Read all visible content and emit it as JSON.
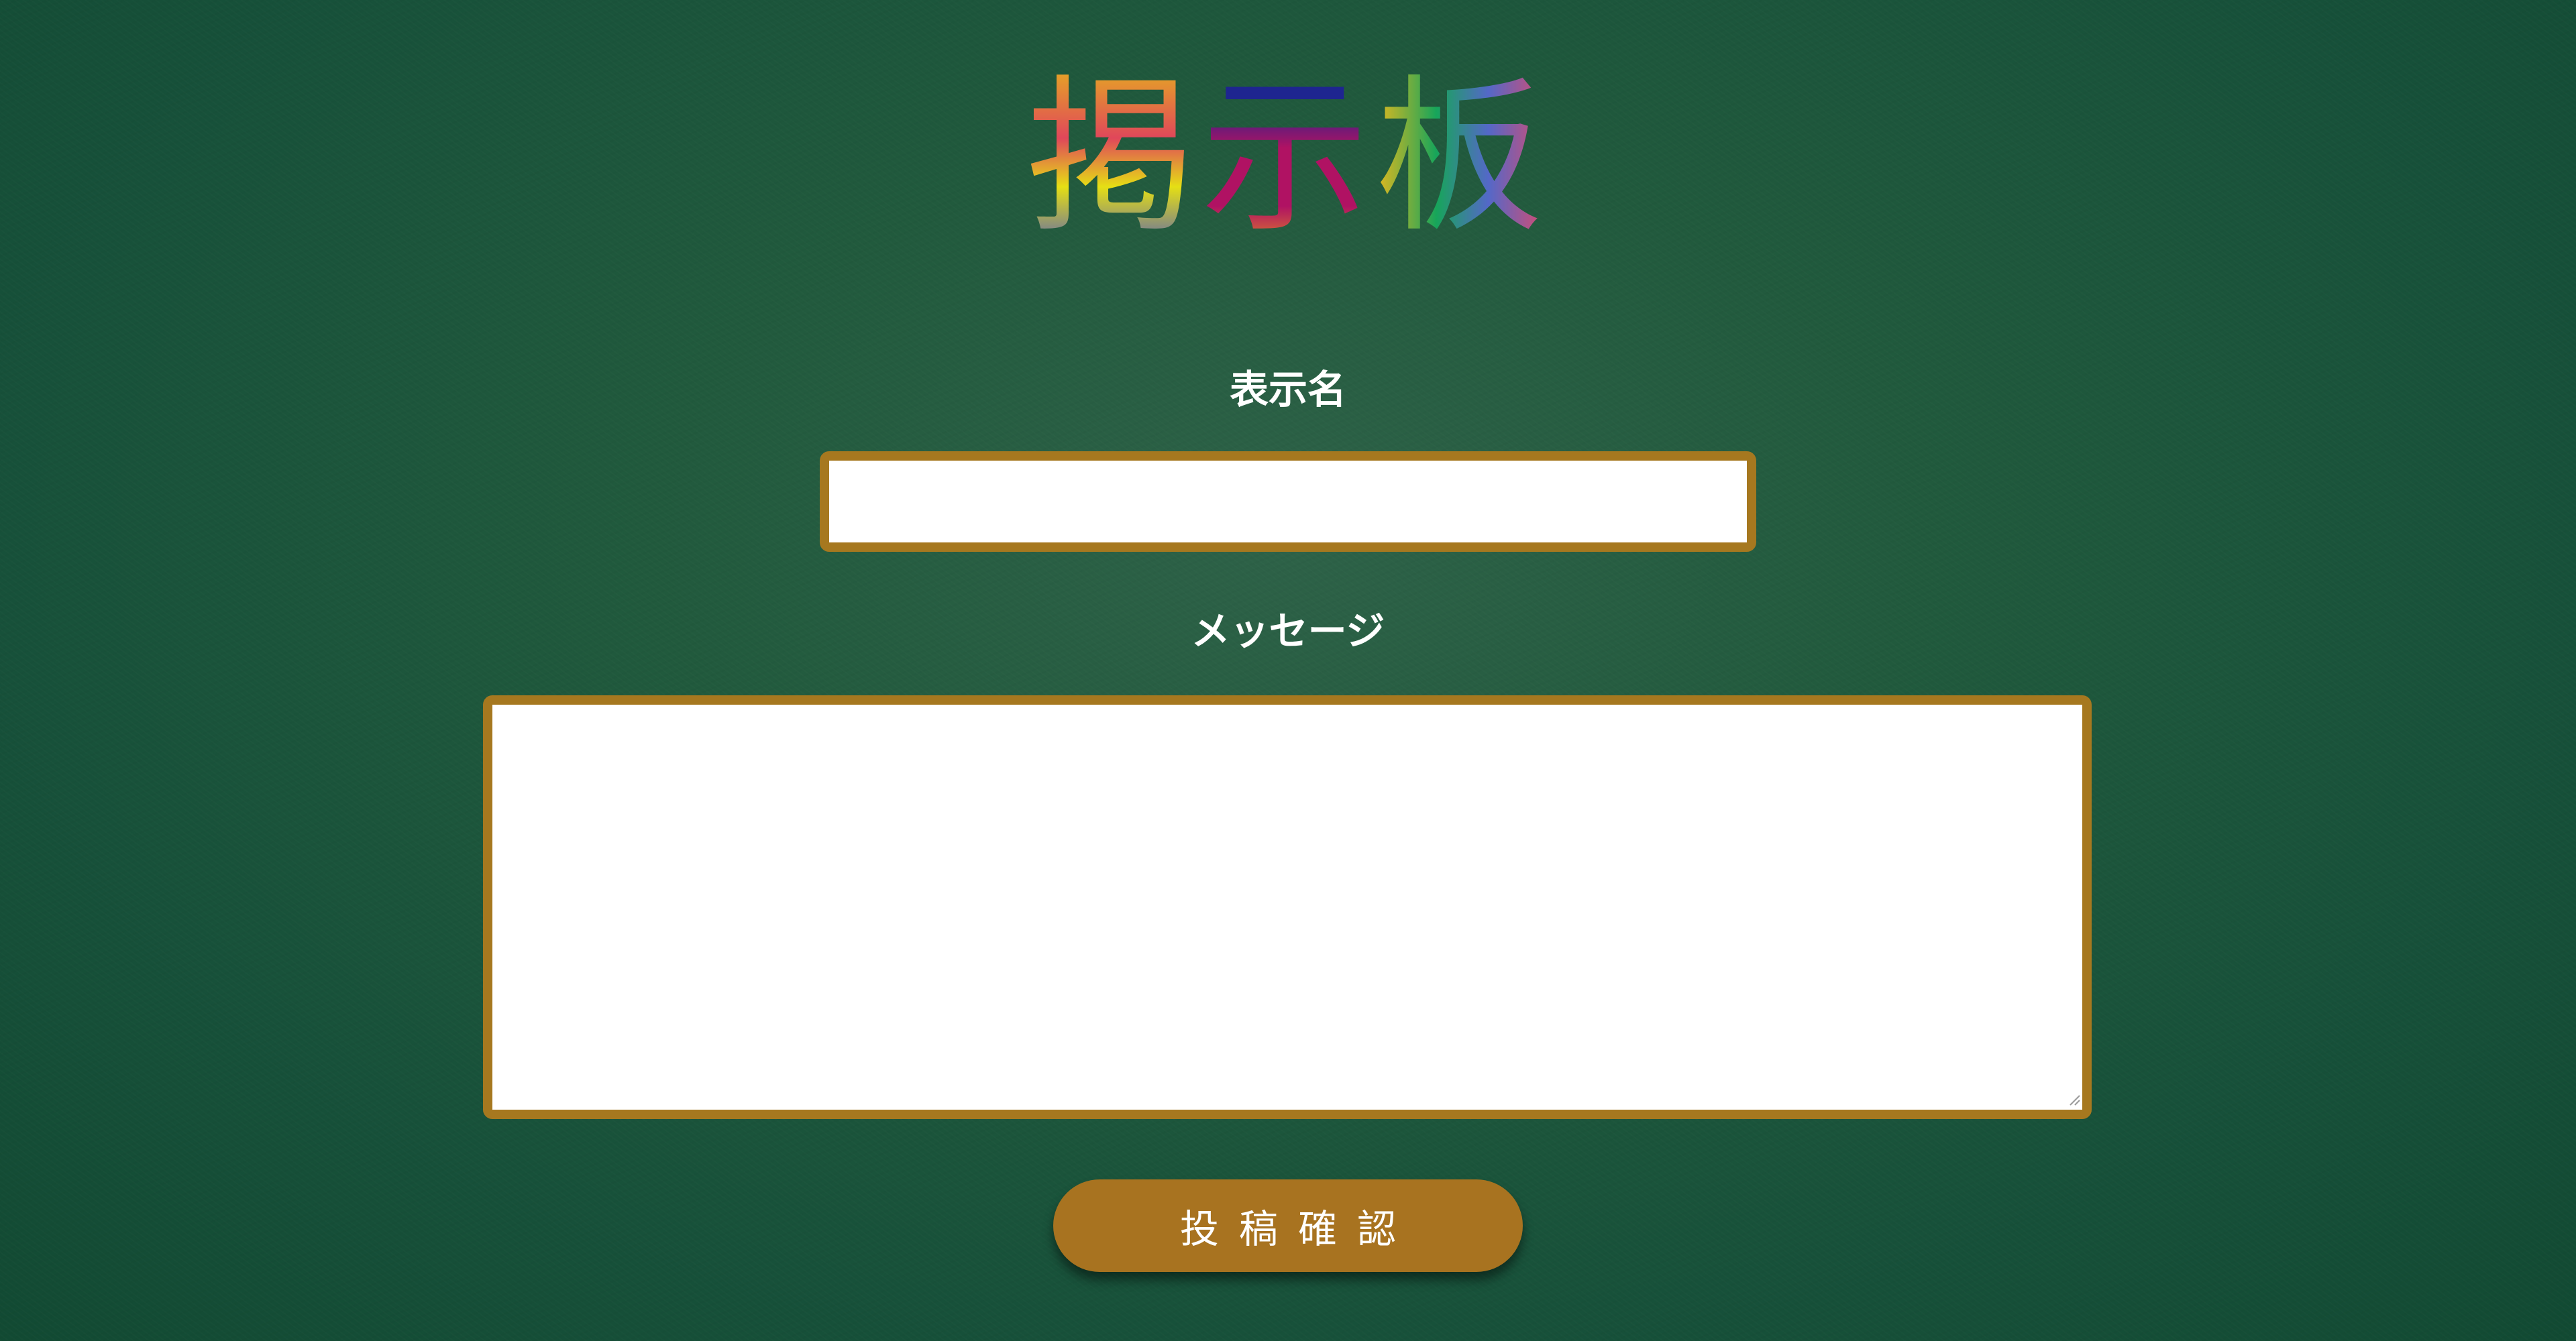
{
  "header": {
    "title_chars": [
      "掲",
      "示",
      "板"
    ]
  },
  "form": {
    "name_label": "表示名",
    "name_value": "",
    "message_label": "メッセージ",
    "message_value": "",
    "submit_label": "投稿確認"
  },
  "colors": {
    "background": "#215a3d",
    "field_border": "#a6781f",
    "button": "#a87320",
    "label_text": "#ffffff"
  }
}
